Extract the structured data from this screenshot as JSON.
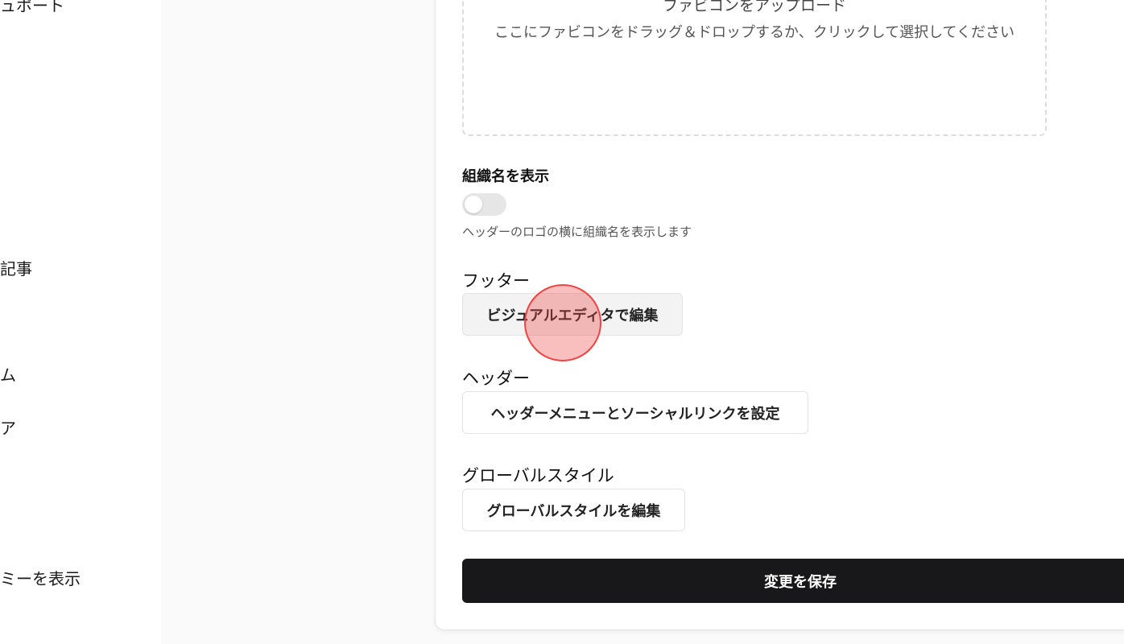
{
  "sidebar": {
    "items": [
      {
        "label": "ュポート"
      },
      {
        "label": "記事"
      },
      {
        "label": "ム"
      },
      {
        "label": "ア"
      },
      {
        "label": "ミーを表示"
      }
    ]
  },
  "favicon": {
    "title": "ファビコンをアップロード",
    "description": "ここにファビコンをドラッグ＆ドロップするか、クリックして選択してください"
  },
  "org_name": {
    "label": "組織名を表示",
    "enabled": false,
    "help": "ヘッダーのロゴの横に組織名を表示します"
  },
  "footer": {
    "label": "フッター",
    "button": "ビジュアルエディタで編集"
  },
  "header": {
    "label": "ヘッダー",
    "button": "ヘッダーメニューとソーシャルリンクを設定"
  },
  "global_style": {
    "label": "グローバルスタイル",
    "button": "グローバルスタイルを編集"
  },
  "save": {
    "label": "変更を保存"
  },
  "colors": {
    "primary": "#18181b",
    "cursor": "#ef4444"
  }
}
